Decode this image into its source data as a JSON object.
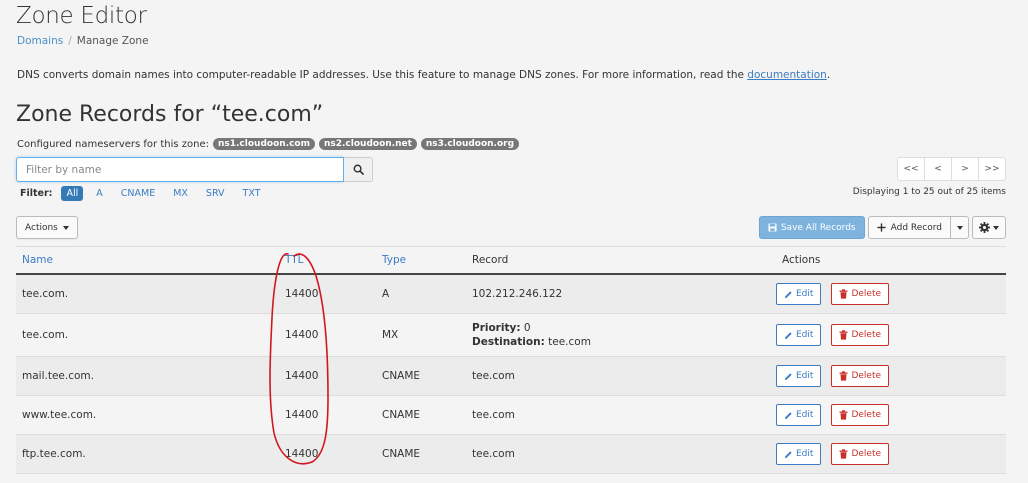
{
  "page": {
    "title": "Zone Editor",
    "breadcrumb": {
      "link": "Domains",
      "current": "Manage Zone"
    },
    "description_text": "DNS converts domain names into computer-readable IP addresses. Use this feature to manage DNS zones. For more information, read the ",
    "description_link": "documentation",
    "description_end": "."
  },
  "zone": {
    "title": "Zone Records for “tee.com”",
    "ns_label": "Configured nameservers for this zone:",
    "nameservers": [
      "ns1.cloudoon.com",
      "ns2.cloudoon.net",
      "ns3.cloudoon.org"
    ]
  },
  "search": {
    "placeholder": "Filter by name",
    "value": ""
  },
  "filter": {
    "label": "Filter:",
    "options": [
      "All",
      "A",
      "CNAME",
      "MX",
      "SRV",
      "TXT"
    ],
    "selected": "All"
  },
  "pagination": {
    "buttons": [
      "<<",
      "<",
      ">",
      ">>"
    ],
    "info": "Displaying 1 to 25 out of 25 items"
  },
  "toolbar": {
    "actions_label": "Actions",
    "save_all_label": "Save All Records",
    "add_record_label": "Add Record"
  },
  "table": {
    "headers": {
      "name": "Name",
      "ttl": "TTL",
      "type": "Type",
      "record": "Record",
      "actions": "Actions"
    },
    "edit_label": "Edit",
    "delete_label": "Delete",
    "rows": [
      {
        "name": "tee.com.",
        "ttl": "14400",
        "type": "A",
        "record": "102.212.246.122"
      },
      {
        "name": "tee.com.",
        "ttl": "14400",
        "type": "MX",
        "priority_label": "Priority:",
        "priority": "0",
        "destination_label": "Destination:",
        "destination": "tee.com"
      },
      {
        "name": "mail.tee.com.",
        "ttl": "14400",
        "type": "CNAME",
        "record": "tee.com"
      },
      {
        "name": "www.tee.com.",
        "ttl": "14400",
        "type": "CNAME",
        "record": "tee.com"
      },
      {
        "name": "ftp.tee.com.",
        "ttl": "14400",
        "type": "CNAME",
        "record": "tee.com"
      }
    ]
  },
  "colors": {
    "link": "#3b7cc4",
    "primary": "#337ab7",
    "danger": "#c9302c",
    "annotation": "#d0191f"
  },
  "icons": [
    "search-icon",
    "save-icon",
    "plus-icon",
    "gear-icon",
    "pencil-icon",
    "trash-icon"
  ]
}
